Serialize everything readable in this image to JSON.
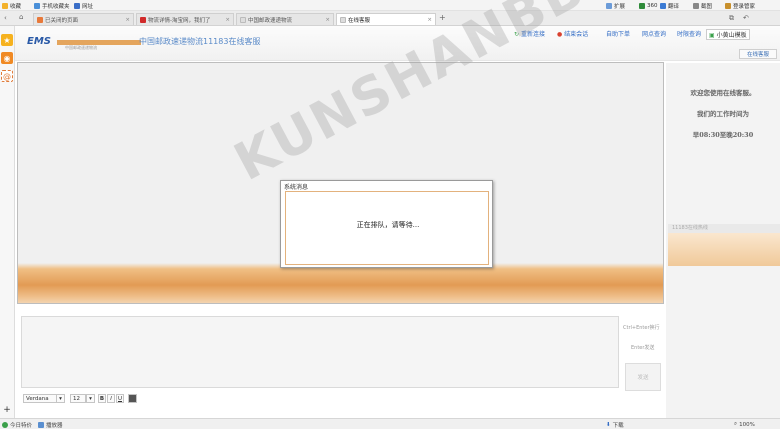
{
  "bookmarks": {
    "items": [
      {
        "label": "收藏"
      },
      {
        "label": "手机收藏夹"
      },
      {
        "label": "网址"
      }
    ],
    "right": [
      {
        "label": "扩展"
      },
      {
        "label": "360"
      },
      {
        "label": "翻译"
      },
      {
        "label": "截图"
      },
      {
        "label": "登录管家"
      }
    ]
  },
  "tabs": [
    {
      "label": "已关闭的页面"
    },
    {
      "label": "物流详情-淘宝网，我们了"
    },
    {
      "label": "中国邮政速递物流"
    },
    {
      "label": "在线客服"
    }
  ],
  "colors": {
    "brand_blue": "#2a5aa7",
    "accent_orange": "#e29b54",
    "link_blue": "#2f6ac4"
  },
  "header": {
    "logo_text": "EMS",
    "logo_sub": "中国邮政速递物流",
    "title": "中国邮政速递物流11183在线客服",
    "nav": [
      "重新连接",
      "结束会话",
      "自助下单",
      "网点查询",
      "时限查询",
      "小黄山模板"
    ],
    "service_button": "在线客服"
  },
  "modal": {
    "title": "系统消息",
    "message": "正在排队，请等待..."
  },
  "input": {
    "hint_ctrl_enter": "Ctrl+Enter换行",
    "hint_enter": "Enter发送",
    "send_label": "发送"
  },
  "toolbar": {
    "font": "Verdana",
    "size": "12",
    "bold": "B",
    "italic": "I",
    "underline": "U"
  },
  "side_panel": {
    "welcome_line1": "欢迎您使用在线客服。",
    "welcome_line2": "我们的工作时间为",
    "welcome_line3": "早08:30至晚20:30",
    "hotline_label": "11183在线热线"
  },
  "watermark": "KUNSHANBBS",
  "status": {
    "left1": "今日特价",
    "left2": "播放器",
    "download": "下载",
    "zoom": "100%"
  }
}
